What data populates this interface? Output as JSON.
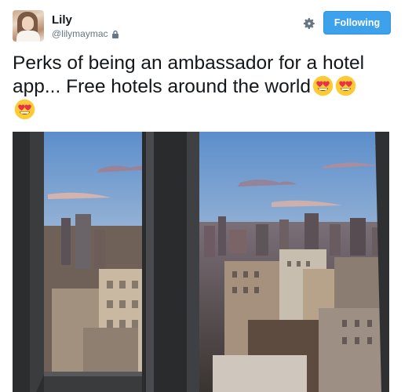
{
  "user": {
    "name": "Lily",
    "handle": "@lilymaymac"
  },
  "actions": {
    "follow_label": "Following"
  },
  "tweet": {
    "text": "Perks of being an ambassador for a hotel app... Free hotels around the world"
  },
  "icons": {
    "lock": "lock-icon",
    "settings": "gear-icon",
    "emoji": "heart-eyes-emoji"
  },
  "colors": {
    "accent": "#3ea1ec",
    "text": "#14171a",
    "secondary": "#657786"
  }
}
